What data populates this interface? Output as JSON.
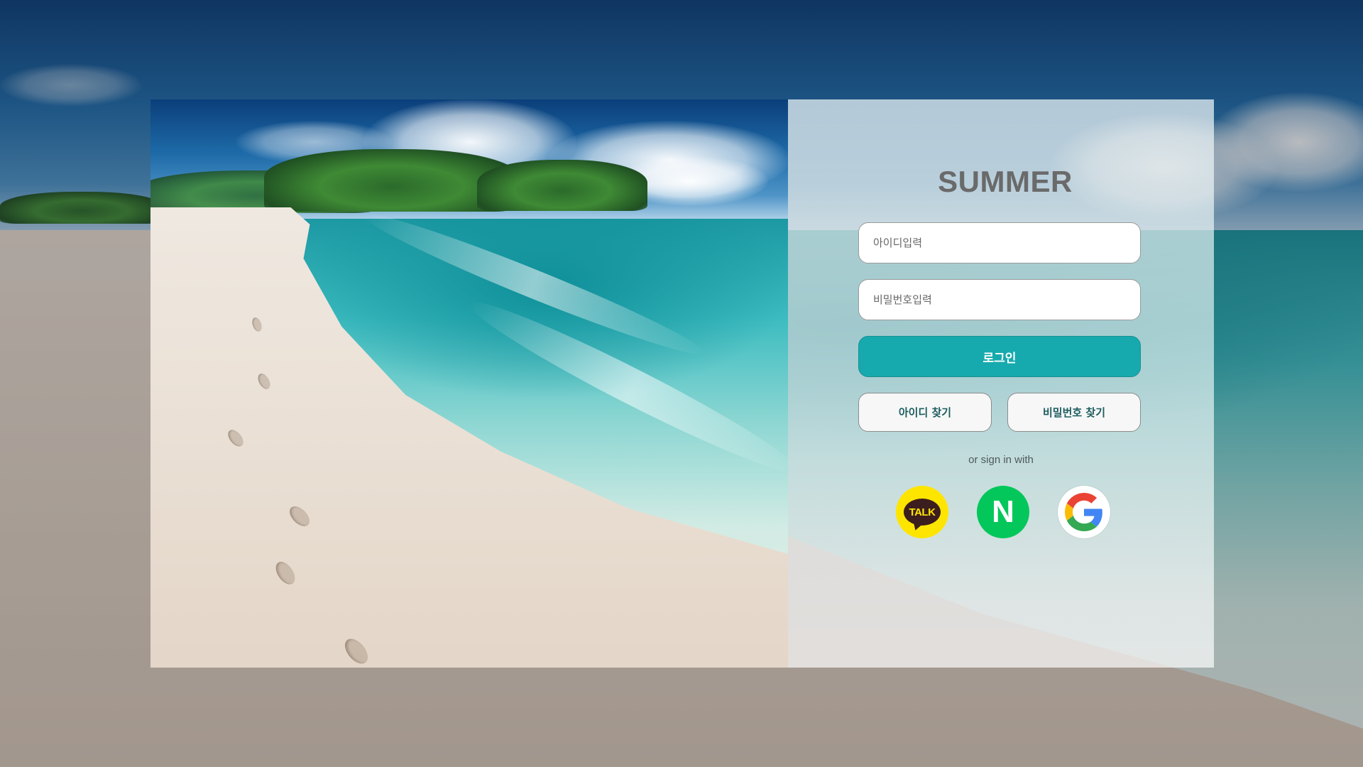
{
  "brand": {
    "title": "SUMMER"
  },
  "login_form": {
    "id_placeholder": "아이디입력",
    "password_placeholder": "비밀번호입력",
    "login_label": "로그인",
    "find_id_label": "아이디 찾기",
    "find_password_label": "비밀번호 찾기",
    "social_prompt": "or sign in with"
  },
  "social_providers": [
    {
      "name": "kakao",
      "icon": "kakao-talk-icon",
      "label": "TALK",
      "color": "#fee500"
    },
    {
      "name": "naver",
      "icon": "naver-icon",
      "label": "N",
      "color": "#03c75a"
    },
    {
      "name": "google",
      "icon": "google-icon",
      "color": "#ffffff"
    }
  ],
  "colors": {
    "accent": "#16aaae",
    "brand_text": "#6a6a6a",
    "kakao": "#fee500",
    "naver": "#03c75a"
  }
}
